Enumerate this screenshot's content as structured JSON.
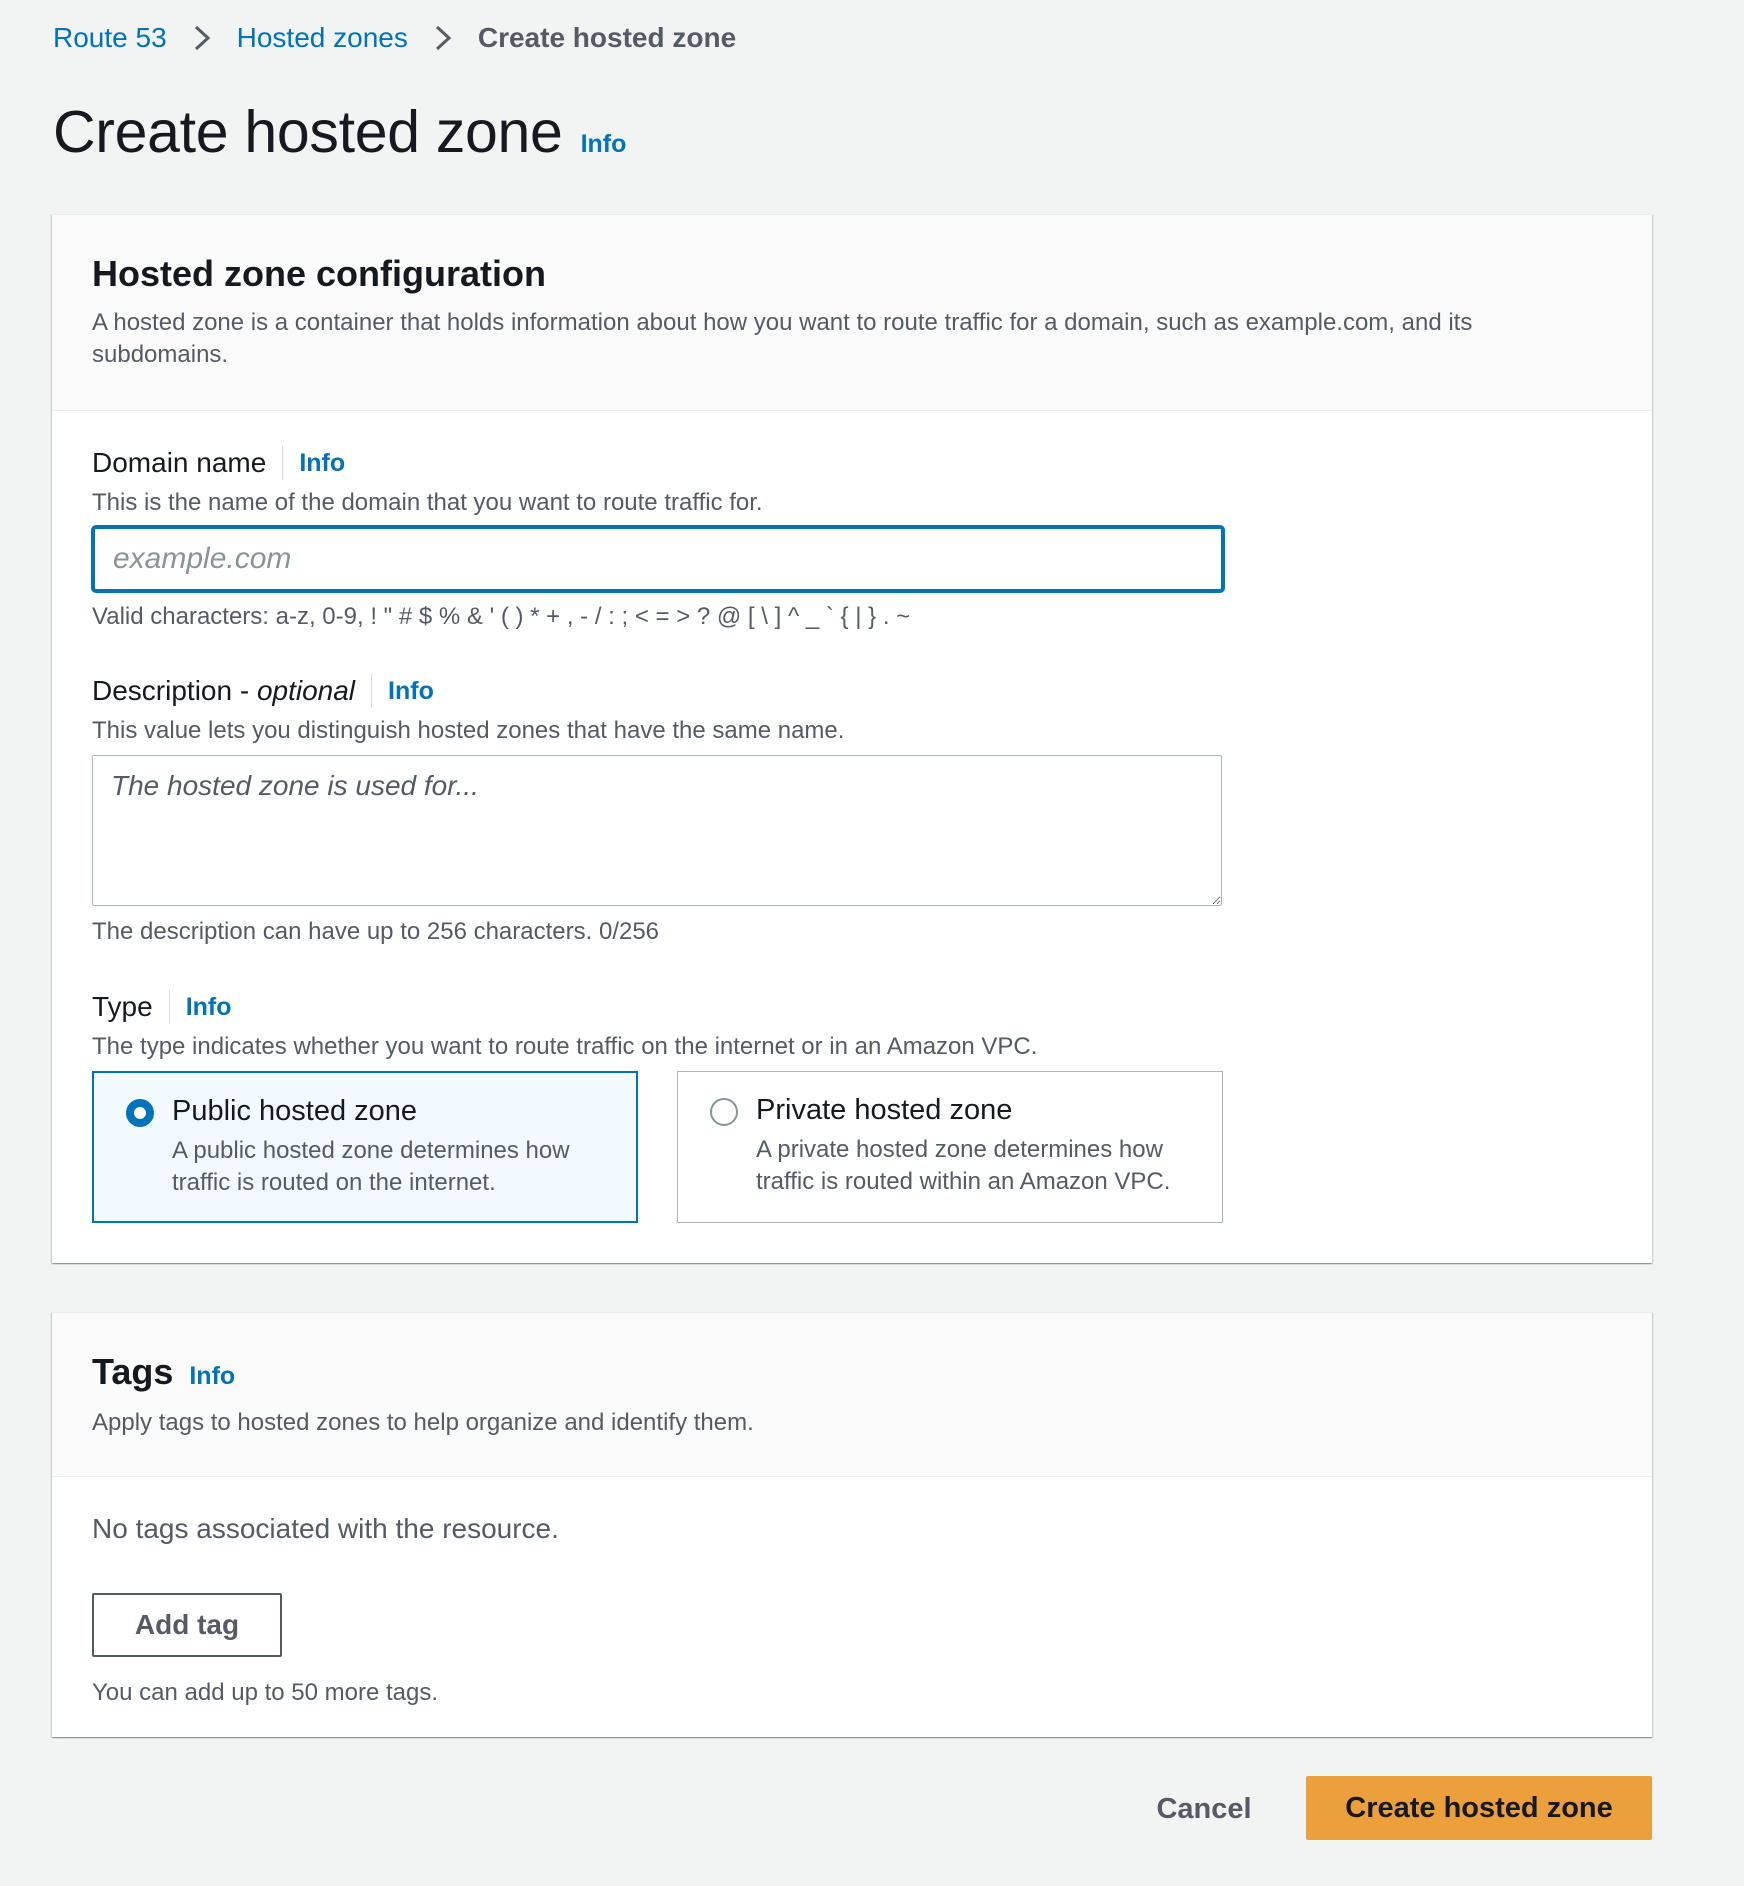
{
  "breadcrumb": {
    "items": [
      "Route 53",
      "Hosted zones"
    ],
    "current": "Create hosted zone"
  },
  "page": {
    "title": "Create hosted zone",
    "info": "Info"
  },
  "config": {
    "title": "Hosted zone configuration",
    "description": "A hosted zone is a container that holds information about how you want to route traffic for a domain, such as example.com, and its subdomains.",
    "domain": {
      "label": "Domain name",
      "info": "Info",
      "description": "This is the name of the domain that you want to route traffic for.",
      "value": "",
      "placeholder": "example.com",
      "constraint": "Valid characters: a-z, 0-9, ! \" # $ % & ' ( ) * + , - / : ; < = > ? @ [ \\ ] ^ _ ` { | } . ~"
    },
    "description_field": {
      "label": "Description - ",
      "label_optional": "optional",
      "info": "Info",
      "description": "This value lets you distinguish hosted zones that have the same name.",
      "value": "",
      "placeholder": "The hosted zone is used for...",
      "constraint": "The description can have up to 256 characters. 0/256"
    },
    "type": {
      "label": "Type",
      "info": "Info",
      "description": "The type indicates whether you want to route traffic on the internet or in an Amazon VPC.",
      "options": [
        {
          "title": "Public hosted zone",
          "description": "A public hosted zone determines how traffic is routed on the internet.",
          "selected": true
        },
        {
          "title": "Private hosted zone",
          "description": "A private hosted zone determines how traffic is routed within an Amazon VPC.",
          "selected": false
        }
      ]
    }
  },
  "tags": {
    "title": "Tags",
    "info": "Info",
    "description": "Apply tags to hosted zones to help organize and identify them.",
    "empty": "No tags associated with the resource.",
    "add_label": "Add tag",
    "constraint": "You can add up to 50 more tags."
  },
  "actions": {
    "cancel_label": "Cancel",
    "create_label": "Create hosted zone"
  },
  "colors": {
    "link": "#0073bb",
    "primary_button": "#ec9f3d",
    "selected_tile_bg": "#f1faff",
    "page_bg": "#f2f3f3"
  }
}
